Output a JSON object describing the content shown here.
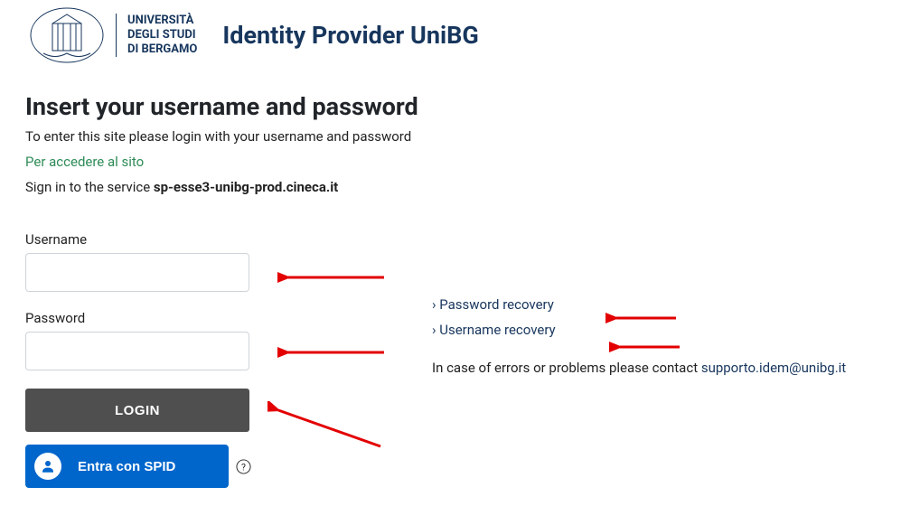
{
  "header": {
    "uni_line1": "UNIVERSITÀ",
    "uni_line2": "DEGLI STUDI",
    "uni_line3": "DI BERGAMO",
    "idp_title": "Identity Provider UniBG"
  },
  "intro": {
    "heading": "Insert your username and password",
    "subtext": "To enter this site please login with your username and password",
    "green_link": "Per accedere al sito",
    "service_prefix": "Sign in to the service ",
    "service_name": "sp-esse3-unibg-prod.cineca.it"
  },
  "form": {
    "username_label": "Username",
    "username_value": "",
    "password_label": "Password",
    "password_value": "",
    "login_label": "LOGIN",
    "spid_label": "Entra con SPID"
  },
  "right": {
    "password_recovery": "Password recovery",
    "username_recovery": "Username recovery",
    "contact_text": "In case of errors or problems please contact ",
    "contact_email": "supporto.idem@unibg.it"
  }
}
